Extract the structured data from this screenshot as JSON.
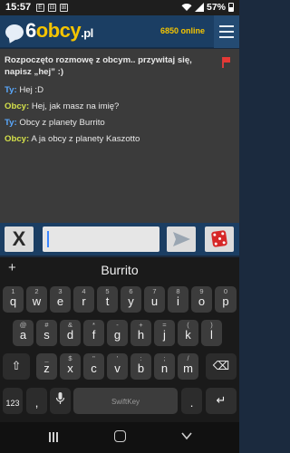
{
  "status_bar": {
    "time": "15:57",
    "notif_icons": [
      "E",
      "⊟",
      "⊞"
    ],
    "battery": "57%"
  },
  "header": {
    "logo_six": "6",
    "logo_obcy": "obcy",
    "logo_pl": ".pl",
    "online_count": "6850 online"
  },
  "chat": {
    "system_message": "Rozpoczęto rozmowę z obcym.. przywitaj się, napisz „hej” :)",
    "messages": [
      {
        "who": "Ty:",
        "text": " Hej :D",
        "role": "ty"
      },
      {
        "who": "Obcy:",
        "text": " Hej, jak masz na imię?",
        "role": "obcy"
      },
      {
        "who": "Ty:",
        "text": " Obcy z planety Burrito",
        "role": "ty"
      },
      {
        "who": "Obcy:",
        "text": " A ja obcy z planety Kaszotto",
        "role": "obcy"
      }
    ]
  },
  "input": {
    "value": "",
    "placeholder": "",
    "disconnect_label": "X"
  },
  "keyboard": {
    "suggestion_plus": "+",
    "suggestion_word": "Burrito",
    "brand": "SwiftKey",
    "row1": [
      {
        "k": "q",
        "a": "1"
      },
      {
        "k": "w",
        "a": "2"
      },
      {
        "k": "e",
        "a": "3"
      },
      {
        "k": "r",
        "a": "4"
      },
      {
        "k": "t",
        "a": "5"
      },
      {
        "k": "y",
        "a": "6"
      },
      {
        "k": "u",
        "a": "7"
      },
      {
        "k": "i",
        "a": "8"
      },
      {
        "k": "o",
        "a": "9"
      },
      {
        "k": "p",
        "a": "0"
      }
    ],
    "row2": [
      {
        "k": "a",
        "a": "@"
      },
      {
        "k": "s",
        "a": "#"
      },
      {
        "k": "d",
        "a": "&"
      },
      {
        "k": "f",
        "a": "*"
      },
      {
        "k": "g",
        "a": "-"
      },
      {
        "k": "h",
        "a": "+"
      },
      {
        "k": "j",
        "a": "="
      },
      {
        "k": "k",
        "a": "("
      },
      {
        "k": "l",
        "a": ")"
      }
    ],
    "row3": [
      {
        "k": "z",
        "a": "_"
      },
      {
        "k": "x",
        "a": "$"
      },
      {
        "k": "c",
        "a": "\""
      },
      {
        "k": "v",
        "a": "'"
      },
      {
        "k": "b",
        "a": ":"
      },
      {
        "k": "n",
        "a": ";"
      },
      {
        "k": "m",
        "a": "/"
      }
    ],
    "shift": "⇧",
    "backspace": "⌫",
    "symbols": "123",
    "comma": ",",
    "mic": "🎙",
    "period": ".",
    "enter": "↵"
  },
  "colors": {
    "header_bg": "#1b3e63",
    "logo_accent": "#f4c400",
    "ty_color": "#5aa9ff",
    "obcy_color": "#d4e04a",
    "report_flag": "#e53935"
  }
}
